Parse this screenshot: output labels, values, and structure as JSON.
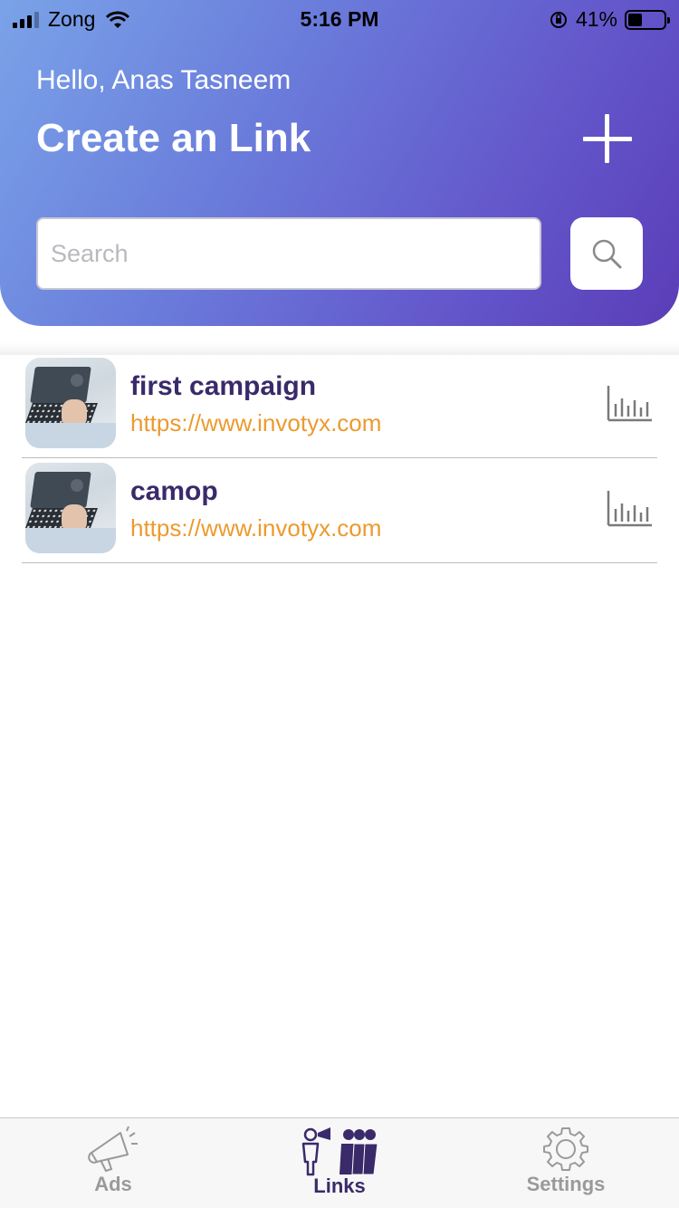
{
  "status_bar": {
    "carrier": "Zong",
    "time": "5:16 PM",
    "battery_percent": "41%",
    "battery_level": 0.41
  },
  "header": {
    "greeting": "Hello, Anas Tasneem",
    "title": "Create an Link",
    "add_icon": "plus-icon"
  },
  "search": {
    "placeholder": "Search",
    "value": "",
    "button_icon": "search-icon"
  },
  "links": [
    {
      "title": "first campaign",
      "url": "https://www.invotyx.com",
      "stats_icon": "bar-chart-icon"
    },
    {
      "title": "camop",
      "url": "https://www.invotyx.com",
      "stats_icon": "bar-chart-icon"
    }
  ],
  "tabbar": {
    "tabs": [
      {
        "label": "Ads",
        "icon": "megaphone-icon",
        "active": false
      },
      {
        "label": "Links",
        "icon": "people-icon",
        "active": true
      },
      {
        "label": "Settings",
        "icon": "gear-icon",
        "active": false
      }
    ]
  },
  "colors": {
    "header_gradient_start": "#7aa3e8",
    "header_gradient_end": "#5a3db8",
    "title_purple": "#3a2a6a",
    "url_orange": "#ec9a2e"
  }
}
